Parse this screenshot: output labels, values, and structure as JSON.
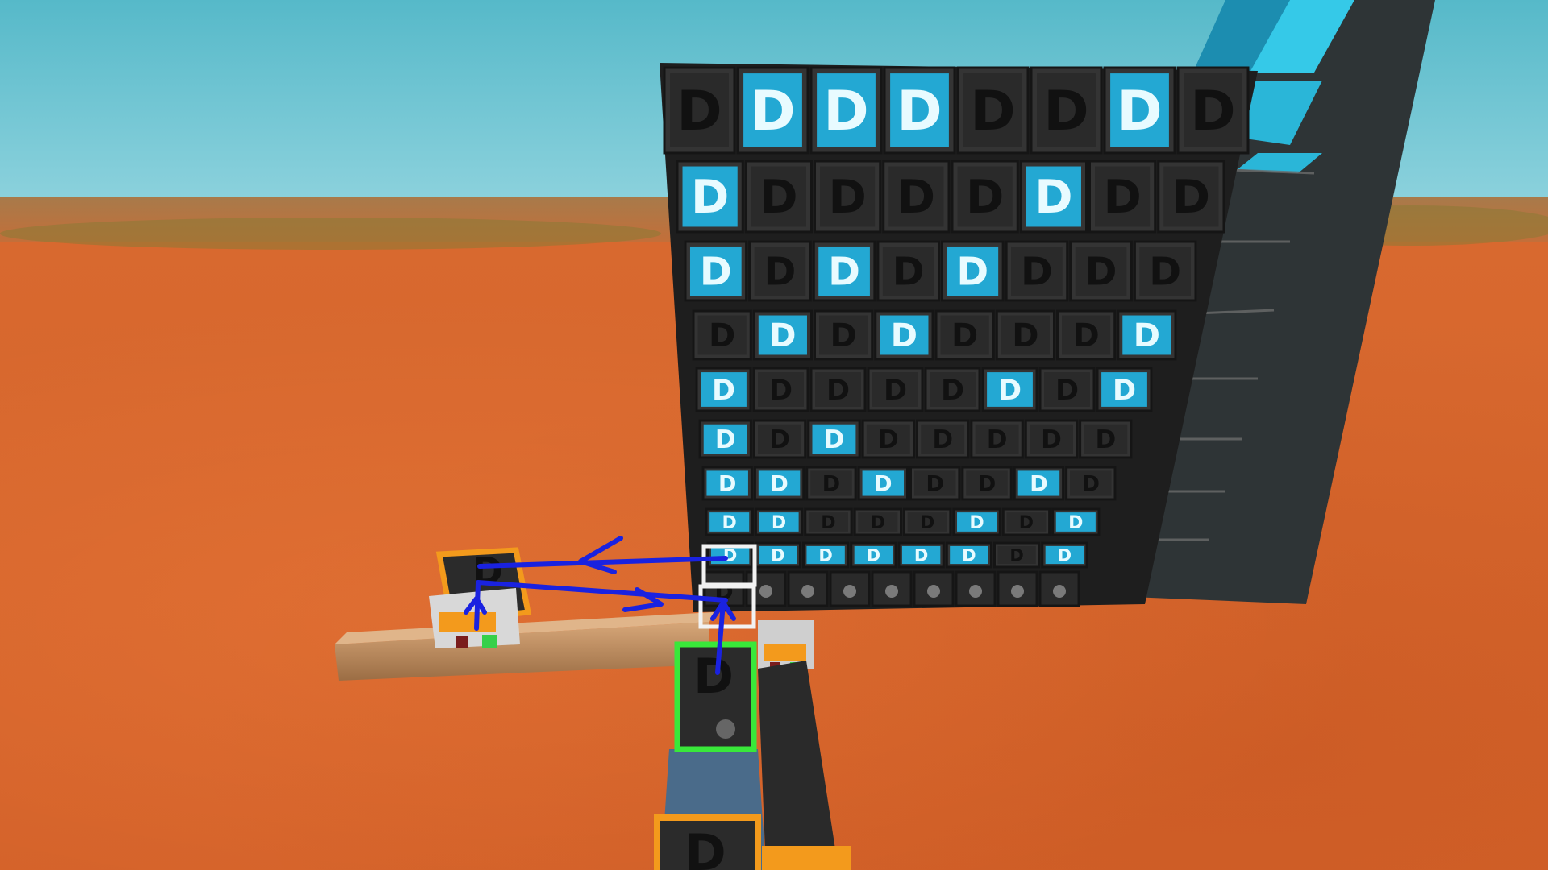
{
  "scene": {
    "description_colors": {
      "sky": "#6cc3d0",
      "ground": "#d8692f",
      "block_off": "#2a2a2a",
      "block_on": "#23a8d3",
      "block_on_glyph": "#e8fbff",
      "block_off_glyph": "#111111",
      "arrow": "#1a22e0",
      "selected_green": "#39e83a",
      "selected_orange": "#f39a1c",
      "selected_white": "#f2f2f2",
      "wood": "#b88a5a"
    },
    "icon": "logic-gate-d-icon",
    "grid": [
      [
        0,
        1,
        1,
        1,
        0,
        0,
        1,
        0
      ],
      [
        1,
        0,
        0,
        0,
        0,
        1,
        0,
        0
      ],
      [
        1,
        0,
        1,
        0,
        1,
        0,
        0,
        0
      ],
      [
        0,
        1,
        0,
        1,
        0,
        0,
        0,
        1
      ],
      [
        1,
        0,
        0,
        0,
        0,
        1,
        0,
        1
      ],
      [
        1,
        0,
        1,
        0,
        0,
        0,
        0,
        0
      ],
      [
        1,
        1,
        0,
        1,
        0,
        0,
        1,
        0
      ],
      [
        1,
        1,
        0,
        0,
        0,
        1,
        0,
        1
      ],
      [
        1,
        1,
        1,
        1,
        1,
        1,
        0,
        1
      ]
    ],
    "glyph": "D"
  }
}
